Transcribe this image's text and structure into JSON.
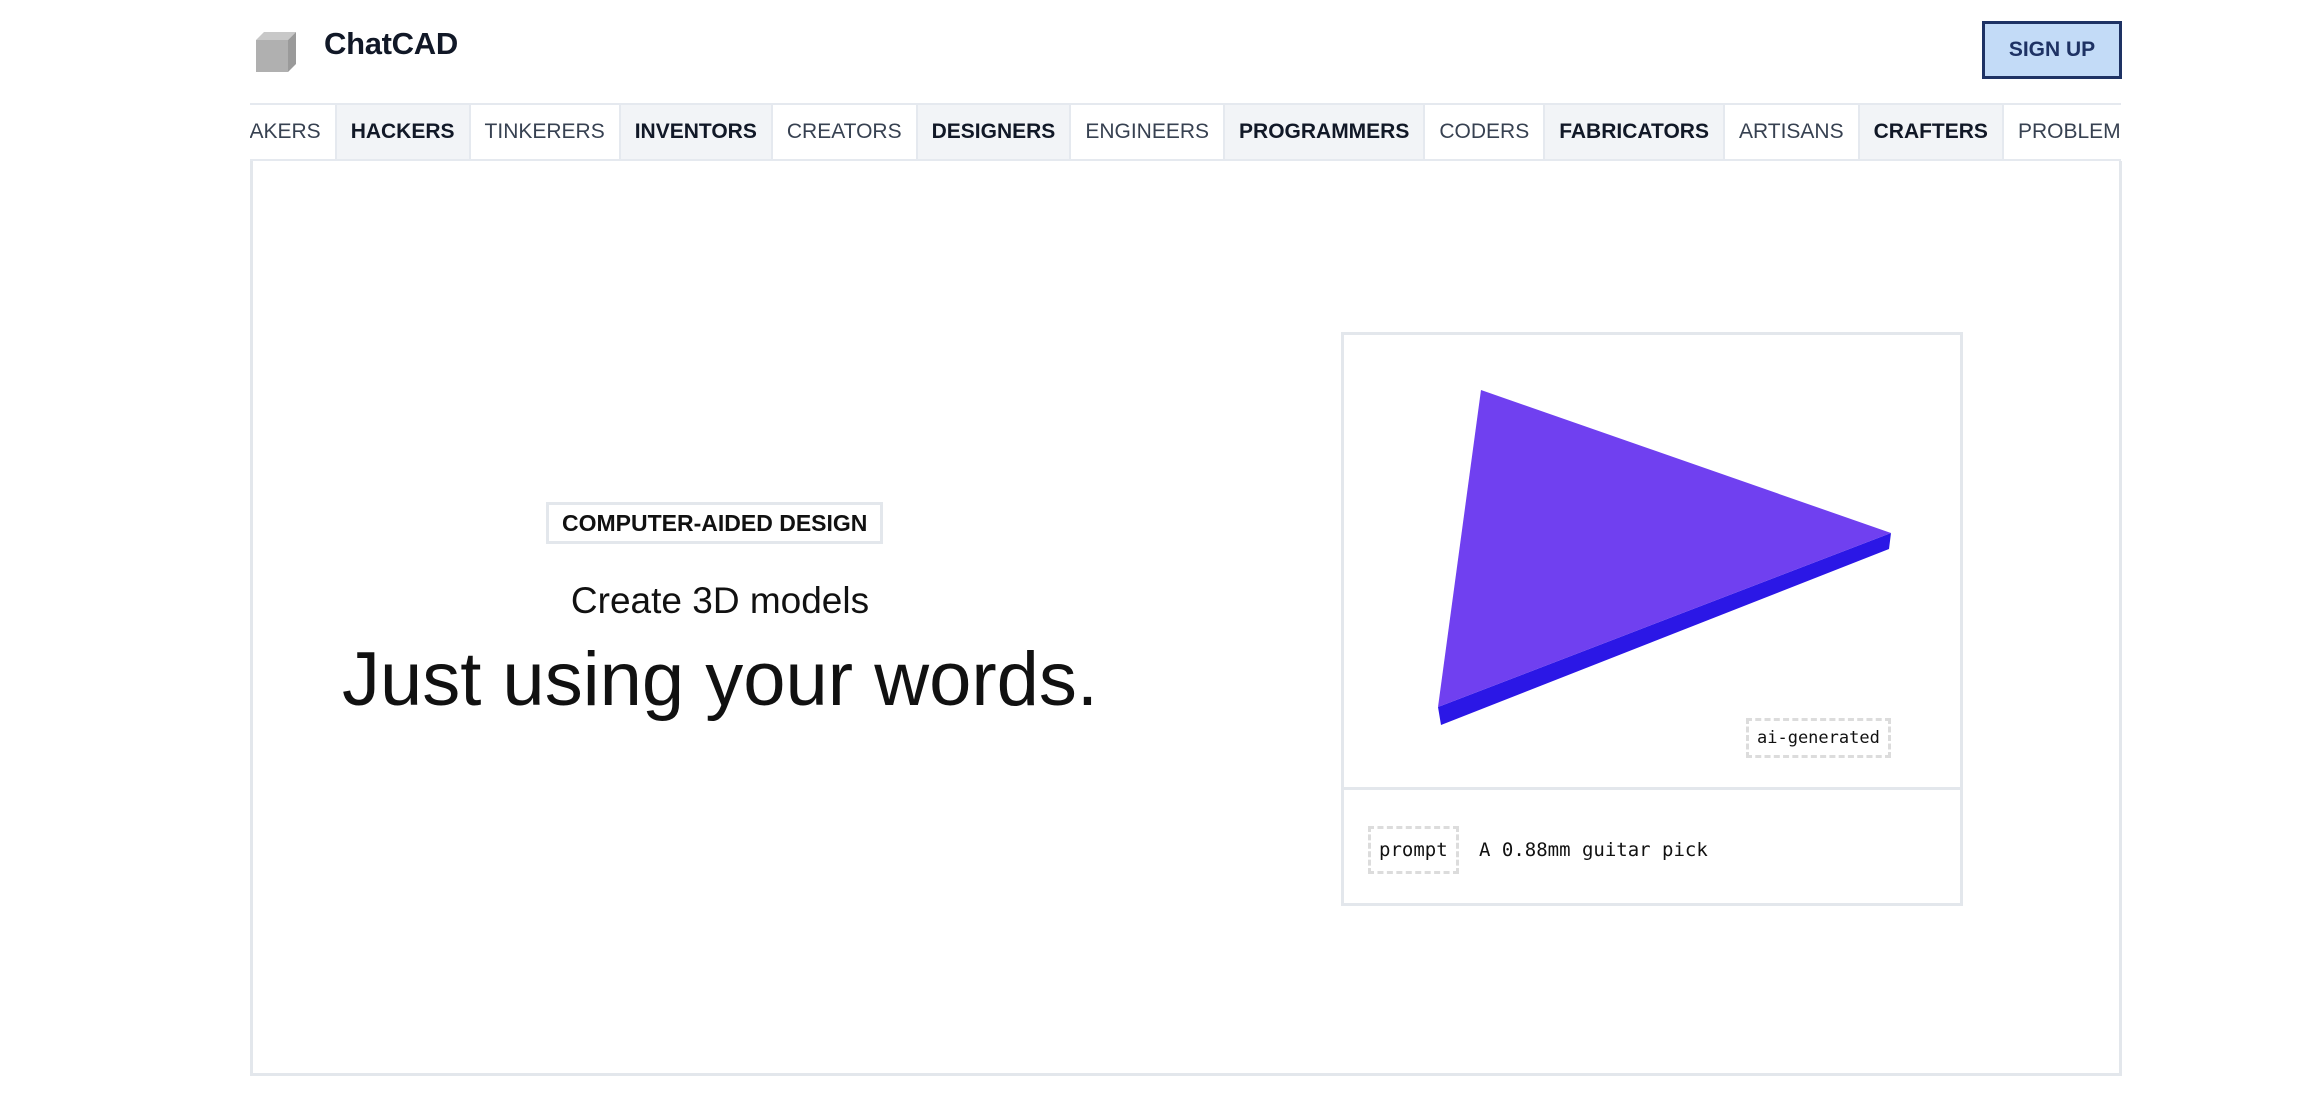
{
  "header": {
    "logo_icon": "cube-icon",
    "title": "ChatCAD",
    "signup_label": "SIGN UP"
  },
  "tabs": [
    {
      "label": "MAKERS",
      "style": "light"
    },
    {
      "label": "HACKERS",
      "style": "bold"
    },
    {
      "label": "TINKERERS",
      "style": "light"
    },
    {
      "label": "INVENTORS",
      "style": "bold"
    },
    {
      "label": "CREATORS",
      "style": "light"
    },
    {
      "label": "DESIGNERS",
      "style": "bold"
    },
    {
      "label": "ENGINEERS",
      "style": "light"
    },
    {
      "label": "PROGRAMMERS",
      "style": "bold"
    },
    {
      "label": "CODERS",
      "style": "light"
    },
    {
      "label": "FABRICATORS",
      "style": "bold"
    },
    {
      "label": "ARTISANS",
      "style": "light"
    },
    {
      "label": "CRAFTERS",
      "style": "bold"
    },
    {
      "label": "PROBLEM-SOLVERS",
      "style": "light"
    }
  ],
  "hero": {
    "badge": "COMPUTER-AIDED DESIGN",
    "subtitle": "Create 3D models",
    "headline": "Just using your words."
  },
  "preview": {
    "model": "guitar-pick-triangle",
    "colors": {
      "top_face": "#7040f0",
      "side_face": "#2b17e6"
    },
    "ai_tag": "ai-generated",
    "prompt_label": "prompt",
    "prompt_text": "A 0.88mm guitar pick"
  },
  "colors": {
    "signup_bg": "#c3dbf7",
    "signup_border": "#1e3264",
    "border": "#e3e7ec",
    "tab_bold_bg": "#f2f4f7"
  }
}
